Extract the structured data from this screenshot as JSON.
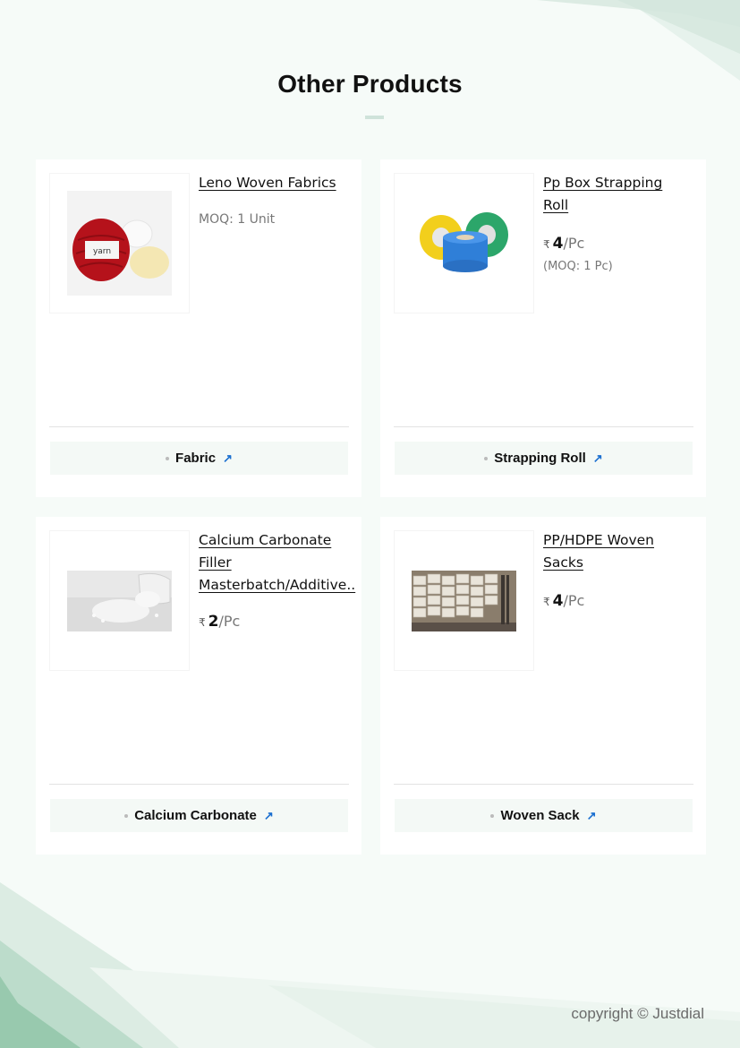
{
  "heading": "Other Products",
  "products": [
    {
      "name": "Leno Woven Fabrics",
      "moq": "MOQ: 1 Unit",
      "price_symbol": "",
      "price_amount": "",
      "price_unit": "",
      "moq_small": "",
      "category": "Fabric",
      "image_icon": "yarn-balls-image"
    },
    {
      "name": "Pp Box Strapping\nRoll",
      "moq": "",
      "price_symbol": "₹",
      "price_amount": "4",
      "price_unit": "/Pc",
      "moq_small": "(MOQ: 1 Pc)",
      "category": "Strapping Roll",
      "image_icon": "strapping-rolls-image"
    },
    {
      "name": "Calcium Carbonate\nFiller\nMasterbatch/Additive..",
      "moq": "",
      "price_symbol": "₹",
      "price_amount": "2",
      "price_unit": "/Pc",
      "moq_small": "",
      "category": "Calcium Carbonate",
      "image_icon": "granules-image"
    },
    {
      "name": "PP/HDPE Woven\nSacks",
      "moq": "",
      "price_symbol": "₹",
      "price_amount": "4",
      "price_unit": "/Pc",
      "moq_small": "",
      "category": "Woven Sack",
      "image_icon": "woven-sacks-image"
    }
  ],
  "arrow_icon": "↗",
  "copyright": "copyright © Justdial"
}
